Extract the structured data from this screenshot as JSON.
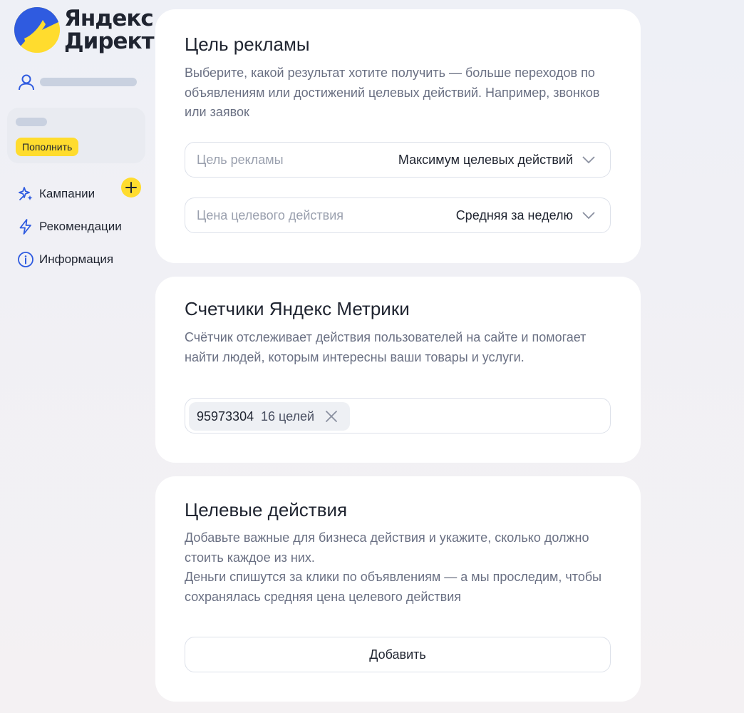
{
  "brand": {
    "line1": "Яндекс",
    "line2": "Директ"
  },
  "sidebar": {
    "topup_label": "Пополнить",
    "items": [
      {
        "label": "Кампании",
        "icon": "sparkle-icon"
      },
      {
        "label": "Рекомендации",
        "icon": "lightning-icon"
      },
      {
        "label": "Информация",
        "icon": "info-icon"
      }
    ]
  },
  "goal_card": {
    "title": "Цель рекламы",
    "description": "Выберите, какой результат хотите получить — больше переходов по объявлениям или достижений целевых действий. Например, звонков или заявок",
    "goal_select": {
      "label": "Цель рекламы",
      "value": "Максимум целевых действий"
    },
    "price_select": {
      "label": "Цена целевого действия",
      "value": "Средняя за неделю"
    }
  },
  "metrika_card": {
    "title": "Счетчики Яндекс Метрики",
    "description": "Счётчик отслеживает действия пользователей на сайте и помогает найти людей, которым интересны ваши товары и услуги.",
    "counter": {
      "id": "95973304",
      "goals": "16 целей"
    }
  },
  "actions_card": {
    "title": "Целевые действия",
    "description_1": "Добавьте важные для бизнеса действия и укажите, сколько должно стоить каждое из них.",
    "description_2": "Деньги спишутся за клики по объявлениям — а мы проследим, чтобы сохранялась средняя цена целевого действия",
    "add_label": "Добавить"
  },
  "colors": {
    "accent_yellow": "#ffdc2e",
    "accent_blue": "#2f5be0",
    "text_muted": "#6a7083"
  }
}
